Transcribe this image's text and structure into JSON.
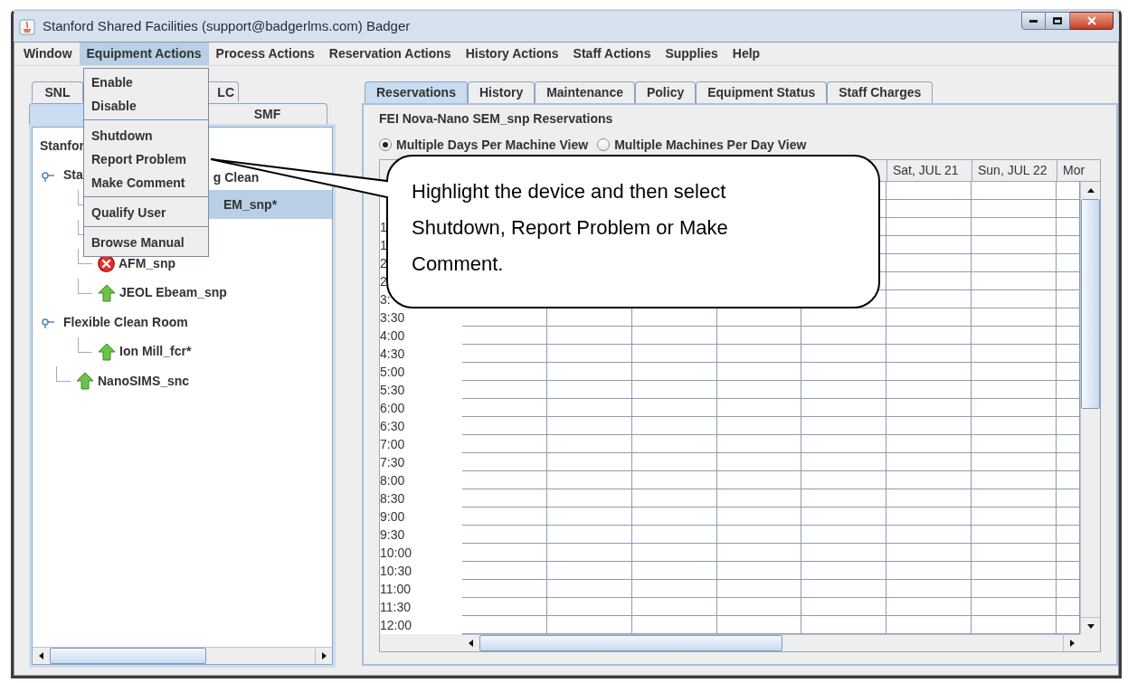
{
  "window": {
    "title": "Stanford Shared Facilities (support@badgerlms.com) Badger"
  },
  "menu_bar": [
    {
      "label": "Window",
      "selected": false
    },
    {
      "label": "Equipment Actions",
      "selected": true
    },
    {
      "label": "Process Actions",
      "selected": false
    },
    {
      "label": "Reservation Actions",
      "selected": false
    },
    {
      "label": "History Actions",
      "selected": false
    },
    {
      "label": "Staff Actions",
      "selected": false
    },
    {
      "label": "Supplies",
      "selected": false
    },
    {
      "label": "Help",
      "selected": false
    }
  ],
  "menu": [
    {
      "kind": "item",
      "label": "Enable"
    },
    {
      "kind": "item",
      "label": "Disable"
    },
    {
      "kind": "separator"
    },
    {
      "kind": "item",
      "label": "Shutdown"
    },
    {
      "kind": "item",
      "label": "Report Problem"
    },
    {
      "kind": "item",
      "label": "Make Comment"
    },
    {
      "kind": "separator"
    },
    {
      "kind": "item",
      "label": "Qualify User"
    },
    {
      "kind": "separator"
    },
    {
      "kind": "item",
      "label": "Browse Manual"
    }
  ],
  "left_tabs": [
    [
      {
        "label": "SNL",
        "selected": false
      },
      {
        "label": "LC",
        "selected": false
      }
    ],
    [
      {
        "selected": true
      },
      {
        "label": "SMF",
        "selected": false
      }
    ]
  ],
  "tree": {
    "root": "Stanfor",
    "children": [
      {
        "label_parts": [
          "Sta",
          "g Clean"
        ],
        "expanded": true,
        "children": [
          {
            "label": "EM_snp*",
            "selected": true
          },
          {
            "selected": false
          },
          {
            "label": "AFM_snp",
            "kind": "down",
            "selected": false
          },
          {
            "label": "JEOL Ebeam_snp",
            "kind": "up",
            "selected": false
          }
        ]
      },
      {
        "label_parts": [
          "Flexible Clean Room"
        ],
        "expanded": true,
        "children": [
          {
            "label": "Ion Mill_fcr*",
            "kind": "up",
            "selected": false
          }
        ]
      },
      {
        "label": "NanoSIMS_snc",
        "kind": "up",
        "selected": false
      }
    ]
  },
  "tabs": [
    {
      "label": "Reservations",
      "selected": true
    },
    {
      "label": "History",
      "selected": false
    },
    {
      "label": "Maintenance",
      "selected": false
    },
    {
      "label": "Policy",
      "selected": false
    },
    {
      "label": "Equipment Status",
      "selected": false
    },
    {
      "label": "Staff Charges",
      "selected": false
    }
  ],
  "reservations": {
    "title": "FEI Nova-Nano SEM_snp Reservations",
    "views": [
      {
        "label": "Multiple Days Per Machine View",
        "selected": true
      },
      {
        "label": "Multiple Machines Per Day View",
        "selected": false
      }
    ],
    "columns": [
      {},
      {},
      {},
      {},
      {},
      {
        "label": "Sat, JUL 21"
      },
      {
        "label": "Sun, JUL 22"
      },
      {
        "label": "Mor"
      }
    ],
    "rows": [
      {},
      {},
      {
        "time": "1"
      },
      {
        "time": "1"
      },
      {
        "time": "2"
      },
      {
        "time": "2"
      },
      {
        "time": "3:"
      },
      {
        "time": "3:30"
      },
      {
        "time": "4:00"
      },
      {
        "time": "4:30"
      },
      {
        "time": "5:00"
      },
      {
        "time": "5:30"
      },
      {
        "time": "6:00"
      },
      {
        "time": "6:30"
      },
      {
        "time": "7:00"
      },
      {
        "time": "7:30"
      },
      {
        "time": "8:00"
      },
      {
        "time": "8:30"
      },
      {
        "time": "9:00"
      },
      {
        "time": "9:30"
      },
      {
        "time": "10:00"
      },
      {
        "time": "10:30"
      },
      {
        "time": "11:00"
      },
      {
        "time": "11:30"
      },
      {
        "time": "12:00"
      }
    ]
  },
  "callout": {
    "text": "Highlight the device and then select Shutdown, Report Problem or Make Comment."
  }
}
